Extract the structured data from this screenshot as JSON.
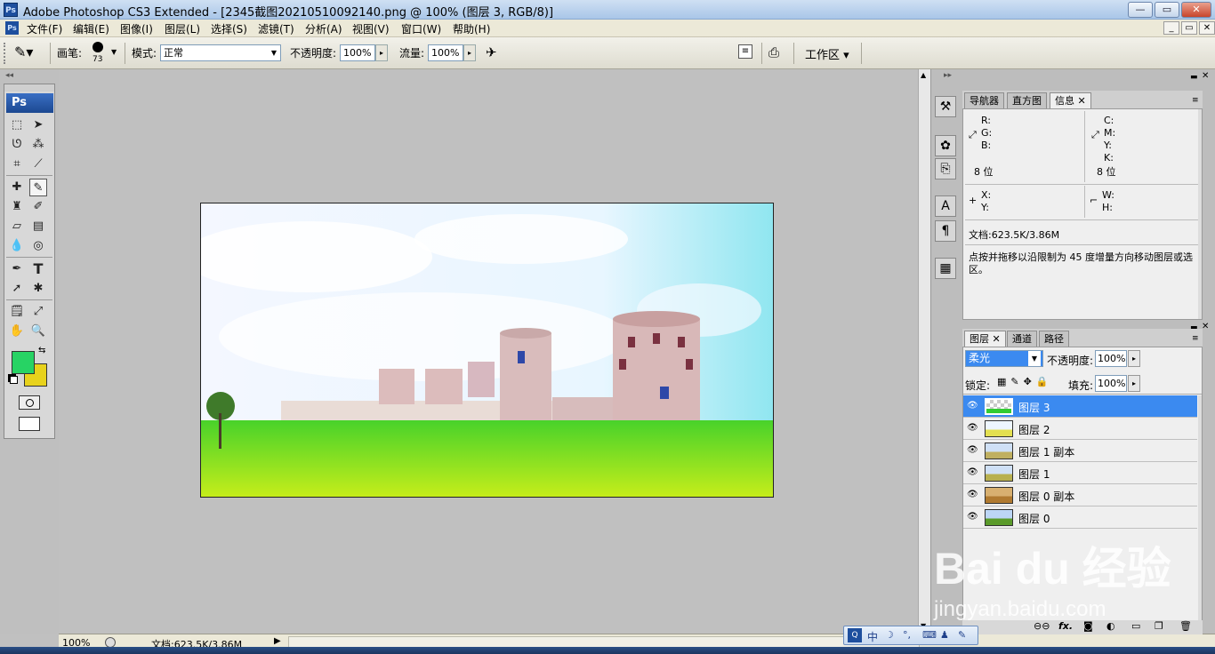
{
  "window": {
    "title": "Adobe Photoshop CS3 Extended - [2345截图20210510092140.png @ 100% (图层 3, RGB/8)]",
    "app_badge": "Ps",
    "controls": [
      "—",
      "▭",
      "✕"
    ]
  },
  "menu": {
    "items": [
      "文件(F)",
      "编辑(E)",
      "图像(I)",
      "图层(L)",
      "选择(S)",
      "滤镜(T)",
      "分析(A)",
      "视图(V)",
      "窗口(W)",
      "帮助(H)"
    ],
    "doc_controls": [
      "_",
      "▭",
      "✕"
    ]
  },
  "options": {
    "brush_label": "画笔:",
    "brush_size": "73",
    "mode_label": "模式:",
    "mode_value": "正常",
    "opacity_label": "不透明度:",
    "opacity_value": "100%",
    "flow_label": "流量:",
    "flow_value": "100%",
    "workspace_label": "工作区"
  },
  "toolbox": {
    "logo": "Ps",
    "foreground_color": "#27d364",
    "background_color": "#e8d21c"
  },
  "status": {
    "zoom": "100%",
    "doc_info": "文档:623.5K/3.86M"
  },
  "panels": {
    "info_tabs": [
      "导航器",
      "直方图",
      "信息"
    ],
    "info_active": "信息",
    "rgb_labels": [
      "R:",
      "G:",
      "B:"
    ],
    "cmyk_labels": [
      "C:",
      "M:",
      "Y:",
      "K:"
    ],
    "bits_left": "8 位",
    "bits_right": "8 位",
    "xy_labels": [
      "X:",
      "Y:"
    ],
    "wh_labels": [
      "W:",
      "H:"
    ],
    "doc": "文档:623.5K/3.86M",
    "hint": "点按并拖移以沿限制为 45 度增量方向移动图层或选区。",
    "layer_tabs": [
      "图层",
      "通道",
      "路径"
    ],
    "blend_mode": "柔光",
    "layer_opacity_label": "不透明度:",
    "layer_opacity": "100%",
    "lock_label": "锁定:",
    "fill_label": "填充:",
    "fill": "100%",
    "layers": [
      {
        "name": "图层 3",
        "selected": true
      },
      {
        "name": "图层 2",
        "selected": false
      },
      {
        "name": "图层 1 副本",
        "selected": false
      },
      {
        "name": "图层 1",
        "selected": false
      },
      {
        "name": "图层 0 副本",
        "selected": false
      },
      {
        "name": "图层 0",
        "selected": false
      }
    ]
  },
  "ime": {
    "items": [
      "中",
      "☽",
      "°,",
      "⌨",
      "♟",
      "✎"
    ]
  },
  "watermark": {
    "line1": "Bai du 经验",
    "line2": "jingyan.baidu.com"
  }
}
